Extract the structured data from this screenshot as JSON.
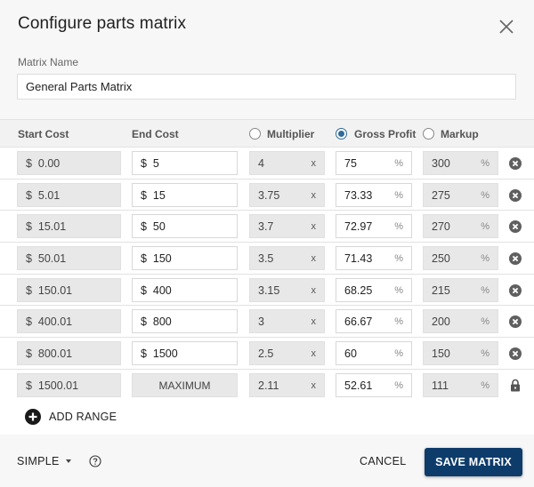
{
  "dialog": {
    "title": "Configure parts matrix",
    "close_icon": "close-icon"
  },
  "matrix_name": {
    "label": "Matrix Name",
    "value": "General Parts Matrix"
  },
  "table": {
    "headers": {
      "start_cost": "Start Cost",
      "end_cost": "End Cost",
      "multiplier": "Multiplier",
      "gross_profit": "Gross Profit",
      "markup": "Markup"
    },
    "selected_mode": "gross_profit",
    "currency_symbol": "$",
    "multiplier_suffix": "x",
    "percent_suffix": "%",
    "rows": [
      {
        "start": "0.00",
        "end": "5",
        "multiplier": "4",
        "gross_profit": "75",
        "markup": "300",
        "action": "remove"
      },
      {
        "start": "5.01",
        "end": "15",
        "multiplier": "3.75",
        "gross_profit": "73.33",
        "markup": "275",
        "action": "remove"
      },
      {
        "start": "15.01",
        "end": "50",
        "multiplier": "3.7",
        "gross_profit": "72.97",
        "markup": "270",
        "action": "remove"
      },
      {
        "start": "50.01",
        "end": "150",
        "multiplier": "3.5",
        "gross_profit": "71.43",
        "markup": "250",
        "action": "remove"
      },
      {
        "start": "150.01",
        "end": "400",
        "multiplier": "3.15",
        "gross_profit": "68.25",
        "markup": "215",
        "action": "remove"
      },
      {
        "start": "400.01",
        "end": "800",
        "multiplier": "3",
        "gross_profit": "66.67",
        "markup": "200",
        "action": "remove"
      },
      {
        "start": "800.01",
        "end": "1500",
        "multiplier": "2.5",
        "gross_profit": "60",
        "markup": "150",
        "action": "remove"
      },
      {
        "start": "1500.01",
        "end": "MAXIMUM",
        "multiplier": "2.11",
        "gross_profit": "52.61",
        "markup": "111",
        "action": "locked"
      }
    ]
  },
  "add_range": {
    "label": "ADD RANGE"
  },
  "footer": {
    "mode_select": "SIMPLE",
    "cancel_label": "CANCEL",
    "save_label": "SAVE MATRIX"
  },
  "colors": {
    "primary": "#0d3c6b",
    "radio_selected": "#2f6a9a"
  }
}
